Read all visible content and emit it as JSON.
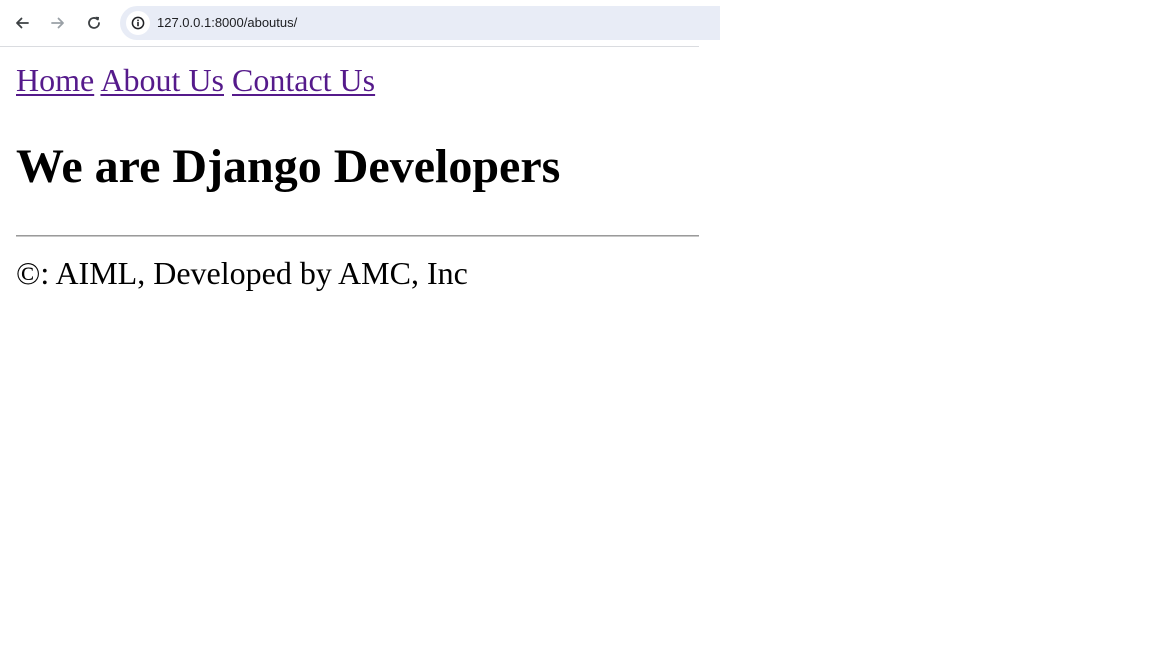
{
  "browser": {
    "url": "127.0.0.1:8000/aboutus/"
  },
  "nav": {
    "home": "Home",
    "about": "About Us",
    "contact": "Contact Us"
  },
  "main": {
    "heading": "We are Django Developers"
  },
  "footer": {
    "text": "©: AIML, Developed by AMC, Inc"
  }
}
